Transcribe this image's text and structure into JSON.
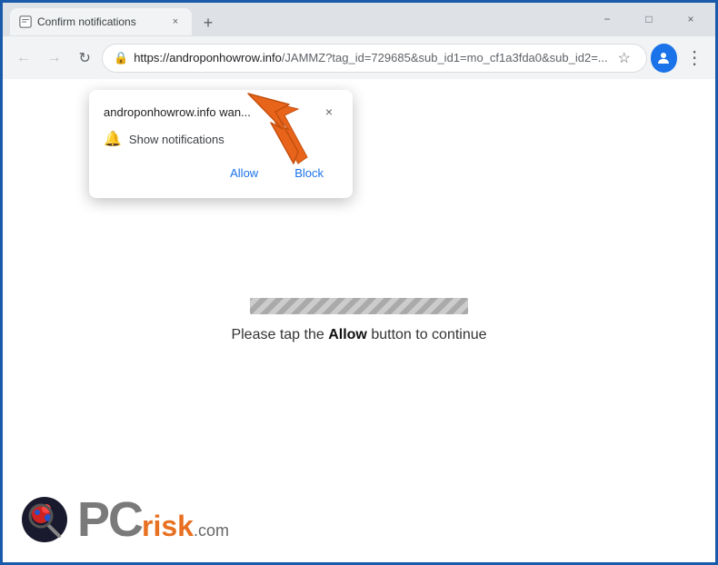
{
  "window": {
    "title": "Confirm notifications",
    "minimize_label": "−",
    "maximize_label": "□",
    "close_label": "×"
  },
  "tab": {
    "title": "Confirm notifications",
    "new_tab_label": "+"
  },
  "addressbar": {
    "url_display": "https://androponhowrow.info/JAMMZ?tag_id=729685&sub_id1=mo_cf1a3fda0&sub_id2=...",
    "url_domain": "https://androponhowrow.info",
    "url_path": "/JAMMZ?tag_id=729685&sub_id1=mo_cf1a3fda0&sub_id2=..."
  },
  "popup": {
    "title": "androponhowrow.info wan...",
    "close_label": "×",
    "row_text": "Show notifications",
    "allow_label": "Allow",
    "block_label": "Block"
  },
  "page": {
    "instruction": "Please tap the ",
    "instruction_bold": "Allow",
    "instruction_end": " button to continue"
  },
  "logo": {
    "pc_text": "PC",
    "risk_text": "risk",
    "dot_com": ".com"
  }
}
